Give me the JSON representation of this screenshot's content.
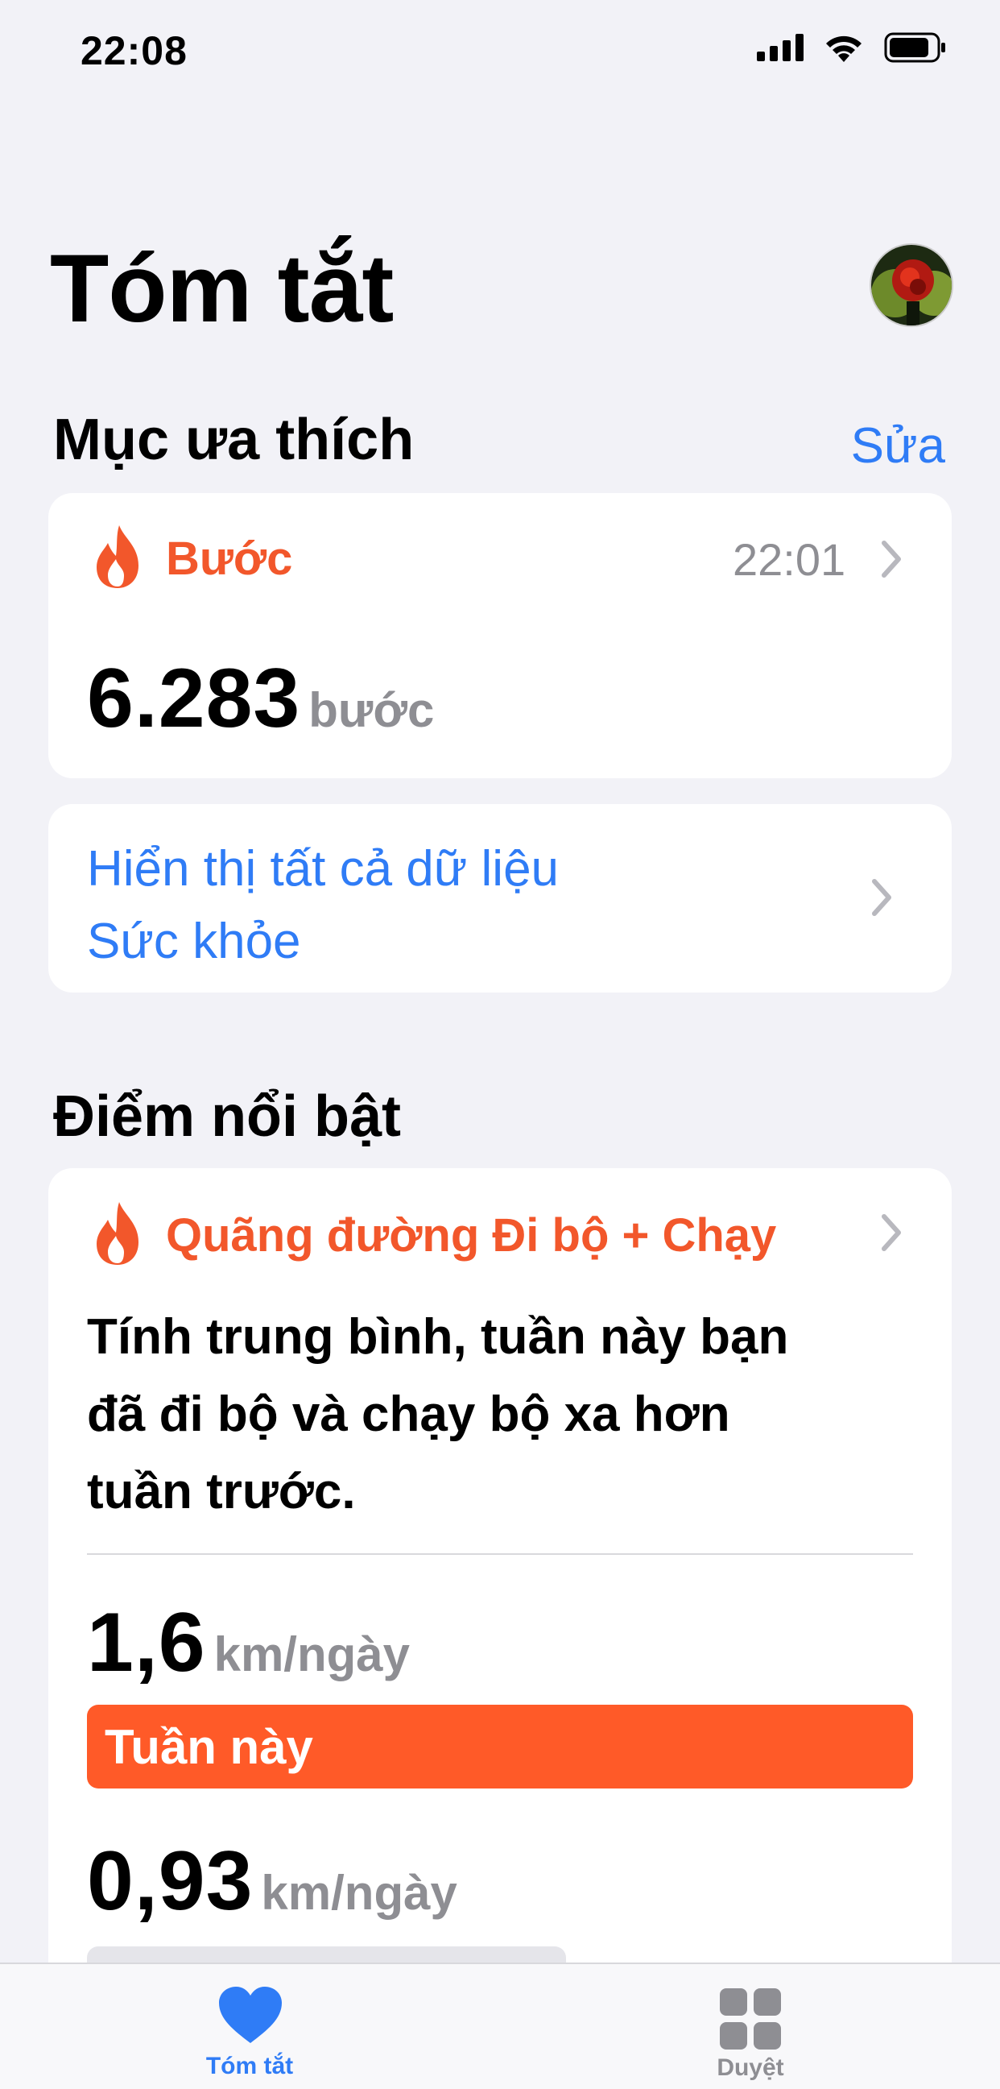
{
  "status_bar": {
    "time": "22:08"
  },
  "page": {
    "title": "Tóm tắt"
  },
  "favorites": {
    "heading": "Mục ưa thích",
    "edit_label": "Sửa",
    "steps_card": {
      "title": "Bước",
      "time": "22:01",
      "value": "6.283",
      "unit": "bước"
    },
    "show_all": {
      "line1": "Hiển thị tất cả dữ liệu",
      "line2": "Sức khỏe"
    }
  },
  "highlights": {
    "heading": "Điểm nổi bật",
    "card": {
      "title": "Quãng đường Đi bộ + Chạy",
      "description_lines": [
        "Tính trung bình, tuần này bạn",
        "đã đi bộ và chạy bộ xa hơn",
        "tuần trước."
      ],
      "this_week": {
        "value": "1,6",
        "unit": "km/ngày",
        "label": "Tuần này",
        "fraction": 1.0
      },
      "last_week": {
        "value": "0,93",
        "unit": "km/ngày",
        "fraction": 0.58
      }
    }
  },
  "tab_bar": {
    "tabs": [
      {
        "label": "Tóm tắt",
        "icon": "heart-icon",
        "selected": true
      },
      {
        "label": "Duyệt",
        "icon": "grid-icon",
        "selected": false
      }
    ]
  },
  "colors": {
    "accent_orange": "#F2572B",
    "accent_blue": "#2F7CF6",
    "gray": "#8E8E93",
    "background": "#F2F2F7"
  }
}
